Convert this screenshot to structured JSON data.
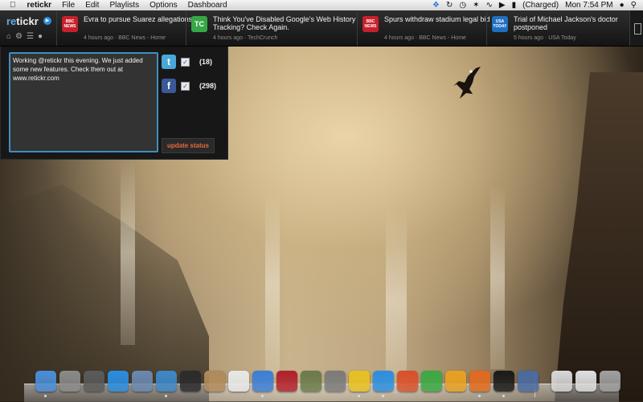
{
  "menubar": {
    "app_name": "retickr",
    "menus": [
      "File",
      "Edit",
      "Playlists",
      "Options",
      "Dashboard"
    ],
    "battery": "(Charged)",
    "clock": "Mon 7:54 PM"
  },
  "ticker": {
    "logo_re": "re",
    "logo_tickr": "tickr",
    "stories": [
      {
        "headline": "Evra to pursue Suarez allegations",
        "meta": "4 hours ago · BBC News - Home",
        "source_badge": "BBC NEWS",
        "badge_color": "#c8202a"
      },
      {
        "headline": "Think You've Disabled Google's Web History Tracking? Check Again.",
        "meta": "4 hours ago · TechCrunch",
        "source_badge": "TC",
        "badge_color": "#35a845"
      },
      {
        "headline": "Spurs withdraw stadium legal bid",
        "meta": "4 hours ago · BBC News - Home",
        "source_badge": "BBC NEWS",
        "badge_color": "#c8202a"
      },
      {
        "headline": "Trial of Michael Jackson's doctor postponed",
        "meta": "5 hours ago · USA Today",
        "source_badge": "USA TODAY",
        "badge_color": "#1f6fc0"
      }
    ]
  },
  "composer": {
    "status_text": "Working @retickr this evening.  We just added some new features.  Check them out at www.retickr.com",
    "twitter_count": "(18)",
    "facebook_count": "(298)",
    "twitter_checked": true,
    "facebook_checked": true,
    "update_label": "update status"
  },
  "dock": {
    "items": [
      {
        "icon": "finder-icon",
        "color": "#4a8fd8"
      },
      {
        "icon": "launchpad-icon",
        "color": "#8a8a8a"
      },
      {
        "icon": "dashboard-icon",
        "color": "#5a5a5a"
      },
      {
        "icon": "app-store-icon",
        "color": "#2a8ee0"
      },
      {
        "icon": "preview-icon",
        "color": "#6a88b0"
      },
      {
        "icon": "safari-icon",
        "color": "#3d88c9"
      },
      {
        "icon": "facetime-icon",
        "color": "#2b2b2b"
      },
      {
        "icon": "contacts-icon",
        "color": "#b08a5a"
      },
      {
        "icon": "calendar-icon",
        "color": "#e8e8e8"
      },
      {
        "icon": "itunes-icon",
        "color": "#3a7ed6"
      },
      {
        "icon": "photo-booth-icon",
        "color": "#b0202a"
      },
      {
        "icon": "iphoto-icon",
        "color": "#6a7a4a"
      },
      {
        "icon": "system-preferences-icon",
        "color": "#7a7a7a"
      },
      {
        "icon": "chrome-icon",
        "color": "#e8c020"
      },
      {
        "icon": "word-icon",
        "color": "#2a8ee0"
      },
      {
        "icon": "powerpoint-icon",
        "color": "#d8502a"
      },
      {
        "icon": "excel-icon",
        "color": "#3aa844"
      },
      {
        "icon": "outlook-icon",
        "color": "#e8a020"
      },
      {
        "icon": "retickr-icon",
        "color": "#e06a20"
      },
      {
        "icon": "console-icon",
        "color": "#1a1a1a"
      },
      {
        "icon": "utility-icon",
        "color": "#4a6aa0"
      },
      {
        "icon": "document-icon",
        "color": "#d8d8d8"
      },
      {
        "icon": "notes-icon",
        "color": "#e0e0e0"
      },
      {
        "icon": "trash-icon",
        "color": "#a0a0a0"
      }
    ]
  }
}
